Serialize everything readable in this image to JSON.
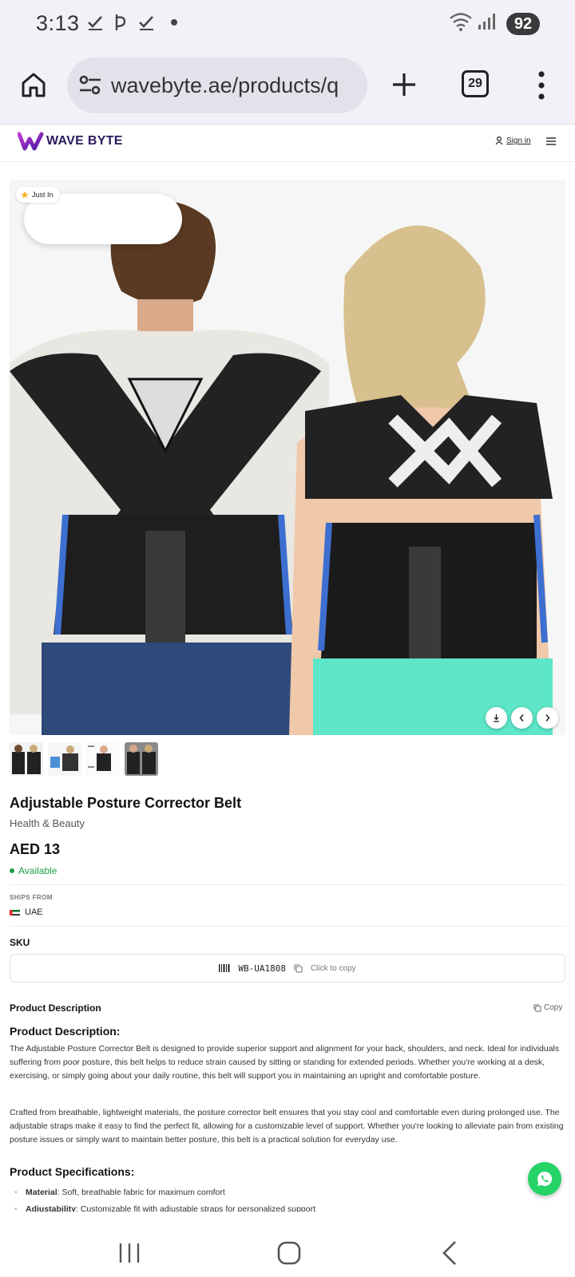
{
  "status_bar": {
    "time": "3:13",
    "battery": "92"
  },
  "browser": {
    "url": "wavebyte.ae/products/q",
    "tab_count": "29"
  },
  "site": {
    "logo_text": "WAVE BYTE",
    "sign_in": "Sign in",
    "brand_color": "#6b1fa6"
  },
  "gallery": {
    "badge": "Just In",
    "thumbnail_count": 4
  },
  "product": {
    "title": "Adjustable Posture Corrector Belt",
    "category": "Health & Beauty",
    "price": "AED 13",
    "availability": "Available",
    "ships_from_label": "SHIPS FROM",
    "ships_from": "UAE",
    "sku_label": "SKU",
    "sku": "WB-UA1808",
    "sku_copy_hint": "Click to copy"
  },
  "description": {
    "heading": "Product Description",
    "copy_label": "Copy",
    "subheading": "Product Description:",
    "paragraph_1": "The Adjustable Posture Corrector Belt is designed to provide superior support and alignment for your back, shoulders, and neck. Ideal for individuals suffering from poor posture, this belt helps to reduce strain caused by sitting or standing for extended periods. Whether you're working at a desk, exercising, or simply going about your daily routine, this belt will support you in maintaining an upright and comfortable posture.",
    "paragraph_2": "Crafted from breathable, lightweight materials, the posture corrector belt ensures that you stay cool and comfortable even during prolonged use. The adjustable straps make it easy to find the perfect fit, allowing for a customizable level of support. Whether you're looking to alleviate pain from existing posture issues or simply want to maintain better posture, this belt is a practical solution for everyday use."
  },
  "specifications": {
    "heading": "Product Specifications:",
    "items": [
      {
        "label": "Material",
        "value": ": Soft, breathable fabric for maximum comfort"
      },
      {
        "label": "Adjustability",
        "value": ": Customizable fit with adjustable straps for personalized support"
      }
    ]
  },
  "colors": {
    "accent_green": "#1e9e4a",
    "whatsapp": "#25d366"
  }
}
